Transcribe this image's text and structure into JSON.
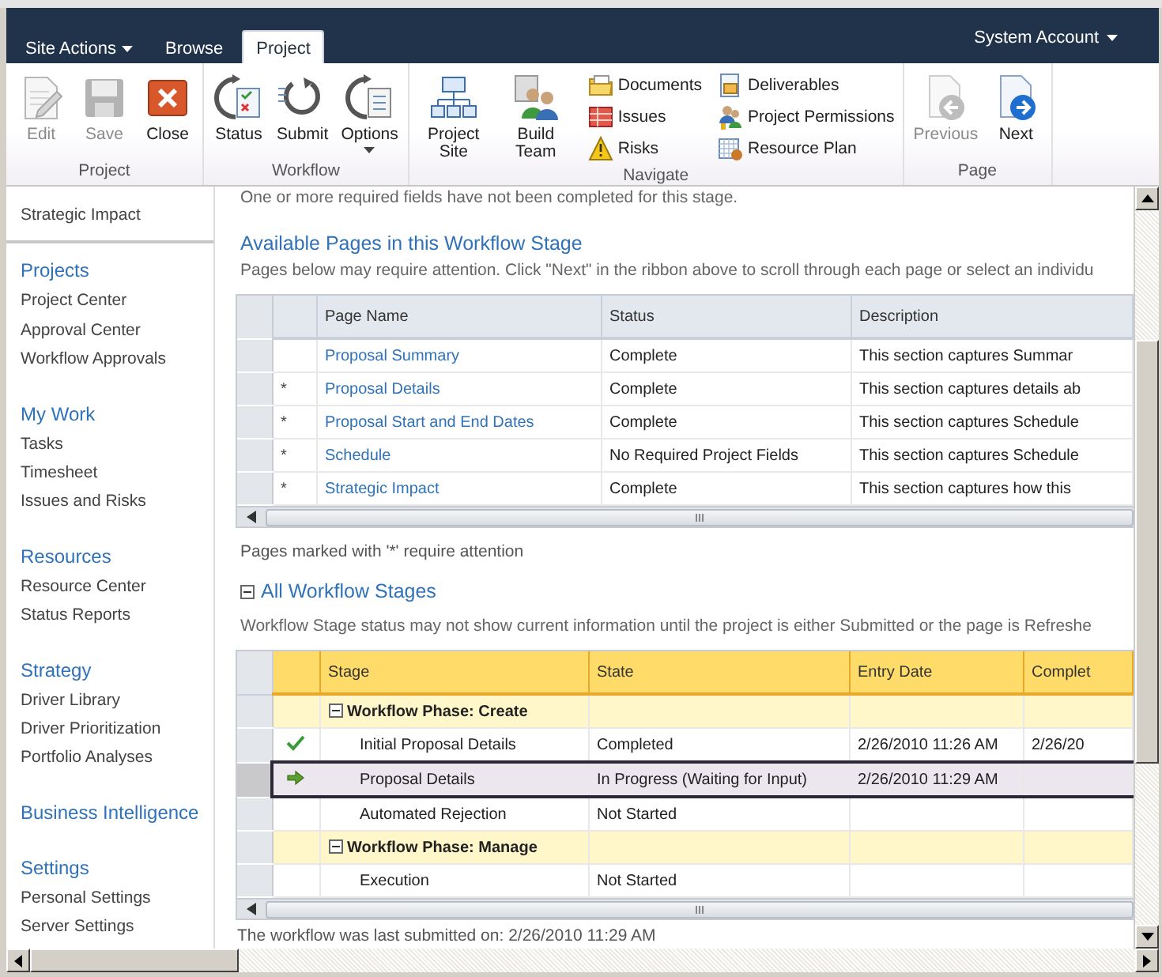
{
  "header": {
    "tabs": [
      {
        "label": "Site Actions",
        "dropdown": true,
        "selected": false
      },
      {
        "label": "Browse",
        "dropdown": false,
        "selected": false
      },
      {
        "label": "Project",
        "dropdown": false,
        "selected": true
      }
    ],
    "account": {
      "label": "System Account",
      "dropdown": true
    }
  },
  "ribbon": {
    "groups": [
      {
        "label": "Project",
        "buttons": [
          {
            "kind": "large",
            "label": "Edit",
            "disabled": true
          },
          {
            "kind": "large",
            "label": "Save",
            "disabled": true
          },
          {
            "kind": "large",
            "label": "Close",
            "disabled": false
          }
        ]
      },
      {
        "label": "Workflow",
        "buttons": [
          {
            "kind": "large",
            "label": "Status",
            "disabled": false
          },
          {
            "kind": "large",
            "label": "Submit",
            "disabled": false
          },
          {
            "kind": "large",
            "label": "Options",
            "dropdown": true,
            "disabled": false
          }
        ]
      },
      {
        "label": "Navigate",
        "buttons": [
          {
            "kind": "large",
            "label": "Project Site",
            "disabled": false
          },
          {
            "kind": "large",
            "label": "Build Team",
            "disabled": false
          },
          {
            "kind": "small",
            "label": "Documents",
            "disabled": false
          },
          {
            "kind": "small",
            "label": "Issues",
            "disabled": false
          },
          {
            "kind": "small",
            "label": "Risks",
            "disabled": false
          },
          {
            "kind": "small",
            "label": "Deliverables",
            "disabled": false
          },
          {
            "kind": "small",
            "label": "Project Permissions",
            "disabled": false
          },
          {
            "kind": "small",
            "label": "Resource Plan",
            "disabled": false
          }
        ]
      },
      {
        "label": "Page",
        "buttons": [
          {
            "kind": "large",
            "label": "Previous",
            "disabled": true
          },
          {
            "kind": "large",
            "label": "Next",
            "disabled": false
          }
        ]
      }
    ]
  },
  "sidebar": {
    "top_item": "Strategic Impact",
    "sections": [
      {
        "heading": "Projects",
        "items": [
          "Project Center",
          "Approval Center",
          "Workflow Approvals"
        ]
      },
      {
        "heading": "My Work",
        "items": [
          "Tasks",
          "Timesheet",
          "Issues and Risks"
        ]
      },
      {
        "heading": "Resources",
        "items": [
          "Resource Center",
          "Status Reports"
        ]
      },
      {
        "heading": "Strategy",
        "items": [
          "Driver Library",
          "Driver Prioritization",
          "Portfolio Analyses"
        ]
      },
      {
        "heading": "Business Intelligence"
      },
      {
        "heading": "Settings",
        "items": [
          "Personal Settings",
          "Server Settings"
        ]
      }
    ]
  },
  "content": {
    "message": "One or more required fields have not been completed for this stage.",
    "pages_section": {
      "title": "Available Pages in this Workflow Stage",
      "intro": "Pages below may require attention. Click \"Next\" in the ribbon above to scroll through each page or select an individu",
      "columns": [
        "Page Name",
        "Status",
        "Description"
      ],
      "rows": [
        {
          "name": "Proposal Summary",
          "status": "Complete",
          "description": "This section captures Summar"
        },
        {
          "marker": "*",
          "name": "Proposal Details",
          "status": "Complete",
          "description": "This section captures details ab"
        },
        {
          "marker": "*",
          "name": "Proposal Start and End Dates",
          "status": "Complete",
          "description": "This section captures Schedule"
        },
        {
          "marker": "*",
          "name": "Schedule",
          "status": "No Required Project Fields",
          "description": "This section captures Schedule"
        },
        {
          "marker": "*",
          "name": "Strategic Impact",
          "status": "Complete",
          "description": "This section captures how this"
        }
      ],
      "footnote": "Pages marked with '*' require attention"
    },
    "stages_section": {
      "title": "All Workflow Stages",
      "expanded": true,
      "intro": "Workflow Stage status may not show current information until the project is either Submitted or the page is Refreshe",
      "columns": [
        "Stage",
        "State",
        "Entry Date",
        "Complet"
      ],
      "rows": [
        {
          "kind": "phase",
          "stage": "Workflow Phase: Create",
          "expanded": true
        },
        {
          "kind": "done",
          "stage": "Initial Proposal Details",
          "state": "Completed",
          "entry_date": "2/26/2010 11:26 AM",
          "completed_date": "2/26/20",
          "selected": false
        },
        {
          "kind": "current",
          "stage": "Proposal Details",
          "state": "In Progress (Waiting for Input)",
          "entry_date": "2/26/2010 11:29 AM",
          "selected": true
        },
        {
          "kind": "pending",
          "stage": "Automated Rejection",
          "state": "Not Started",
          "selected": false
        },
        {
          "kind": "phase",
          "stage": "Workflow Phase: Manage",
          "expanded": true
        },
        {
          "kind": "pending",
          "stage": "Execution",
          "state": "Not Started",
          "selected": false
        }
      ],
      "footer": "The workflow was last submitted on: 2/26/2010 11:29 AM"
    }
  }
}
